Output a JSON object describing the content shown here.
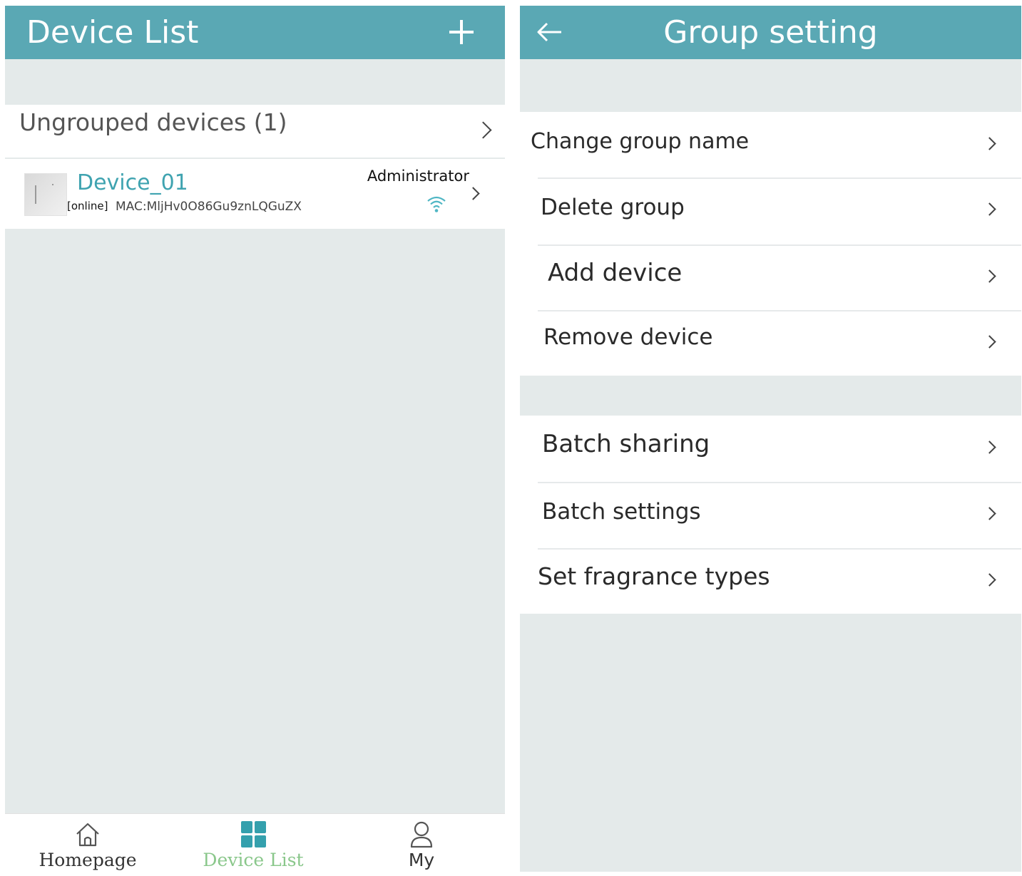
{
  "device_list_screen": {
    "title": "Device List",
    "group": {
      "label": "Ungrouped devices (1)"
    },
    "device": {
      "name": "Device_01",
      "status": "[online]",
      "mac": "MAC:MljHv0O86Gu9znLQGuZX",
      "role": "Administrator"
    },
    "nav": [
      {
        "label": "Homepage"
      },
      {
        "label": "Device List"
      },
      {
        "label": "My"
      }
    ]
  },
  "group_setting_screen": {
    "title": "Group setting",
    "menu_primary": [
      {
        "label": "Change group name"
      },
      {
        "label": "Delete group"
      },
      {
        "label": "Add device"
      },
      {
        "label": "Remove device"
      }
    ],
    "menu_secondary": [
      {
        "label": "Batch sharing"
      },
      {
        "label": "Batch settings"
      },
      {
        "label": "Set fragrance types"
      }
    ]
  },
  "colors": {
    "header": "#5aa8b4",
    "background": "#e4eaea",
    "accent_text": "#3fa3b0",
    "nav_active": "#8ac78b",
    "nav_active_icon": "#34a0ad"
  }
}
